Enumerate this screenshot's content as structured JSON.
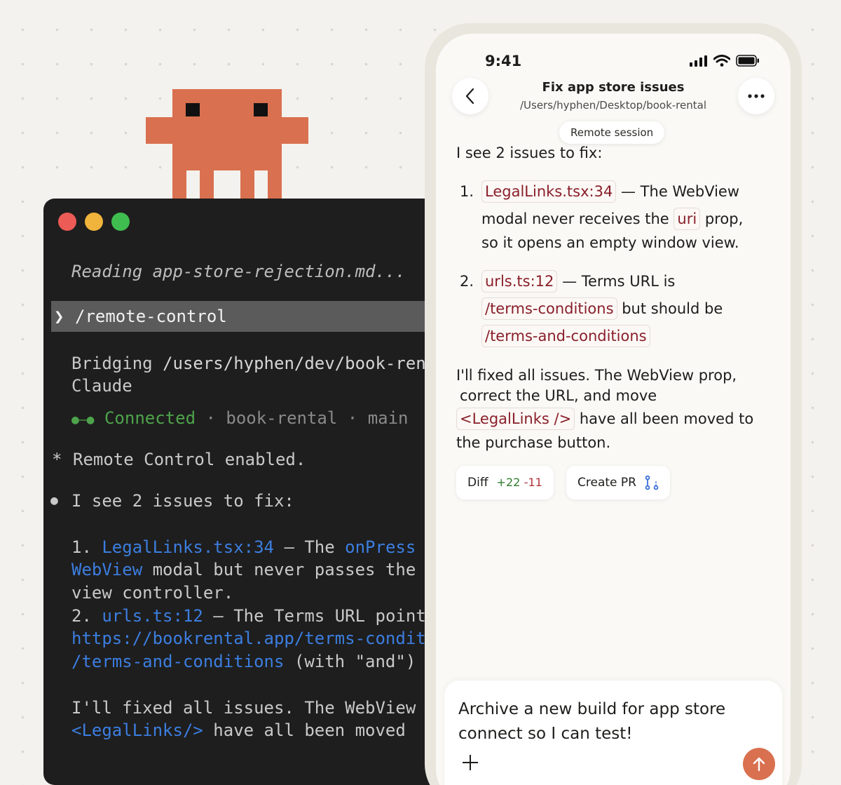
{
  "terminal": {
    "reading": "Reading app-store-rejection.md...",
    "prompt_symbol": "❯",
    "command": "/remote-control",
    "bridging_prefix": "Bridging ",
    "bridging_path": "/users/hyphen/dev/book-rental",
    "bridging_line2": "Claude",
    "connected_glyph": "●—●",
    "connected_label": "Connected",
    "sep": "·",
    "repo": "book-rental",
    "branch": "main",
    "star": "*",
    "remote_enabled": "Remote Control enabled.",
    "bullet": "●",
    "see_issues": "I see 2 issues to fix:",
    "i1_num": "1. ",
    "i1_file": "LegalLinks.tsx:34",
    "i1_dash": " — The ",
    "i1_prop": "onPress",
    "i1_line2_link": "WebView",
    "i1_line2_rest": " modal but never passes the",
    "i1_line3": "view controller.",
    "i2_num": "2. ",
    "i2_file": "urls.ts:12",
    "i2_rest": " — The Terms URL points",
    "i2_url": "https://bookrental.app/terms-conditions",
    "i2_path": "/terms-and-conditions",
    "i2_with": " (with \"and\")",
    "fixed_line": "I'll fixed all issues. The WebView",
    "legal_tag": "<LegalLinks/>",
    "moved_rest": " have all been moved"
  },
  "phone": {
    "time": "9:41",
    "title": "Fix app store issues",
    "path": "/Users/hyphen/Desktop/book-rental",
    "remote_session": "Remote session",
    "intro": "I see 2 issues to fix:",
    "issue1": {
      "num": "1.",
      "file": "LegalLinks.tsx:34",
      "text_a": "— The WebView",
      "text_b": "modal never receives the",
      "code_uri": "uri",
      "text_c": "prop,",
      "text_d": "so it opens an empty window view."
    },
    "issue2": {
      "num": "2.",
      "file": "urls.ts:12",
      "text_a": "— Terms URL is",
      "code_wrong": "/terms-conditions",
      "text_b": "but should be",
      "code_right": "/terms-and-conditions"
    },
    "summary": {
      "line1": "I'll fixed all issues. The WebView prop,",
      "line2": "correct the URL, and move",
      "code": "<LegalLinks />",
      "line3": "have all been moved to",
      "line4": "the purchase button."
    },
    "diff": {
      "label": "Diff",
      "added": "+22",
      "removed": "-11"
    },
    "create_pr": "Create PR",
    "composer_text": "Archive a new build for app store connect so I can test!",
    "accent": "#d9704f"
  }
}
